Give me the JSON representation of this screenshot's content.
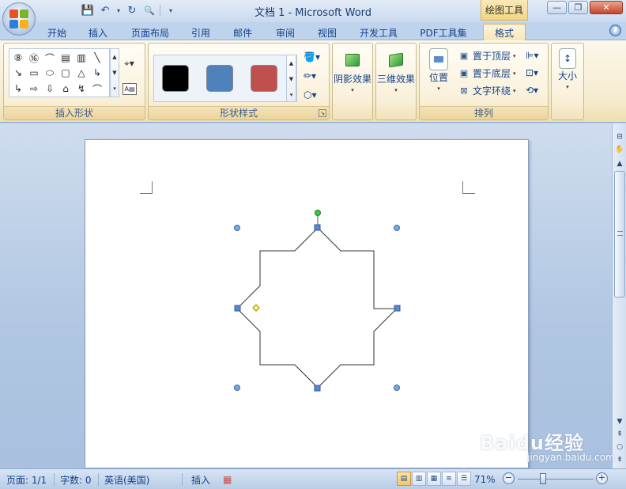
{
  "window": {
    "title": "文档 1 - Microsoft Word",
    "context_tab_title": "绘图工具",
    "controls": {
      "minimize": "—",
      "restore": "❐",
      "close": "✕"
    }
  },
  "quick_access": {
    "items": [
      {
        "name": "save-icon",
        "glyph": "💾"
      },
      {
        "name": "undo-icon",
        "glyph": "↶"
      },
      {
        "name": "dropdown-icon",
        "glyph": "▾"
      },
      {
        "name": "redo-icon",
        "glyph": "↻"
      },
      {
        "name": "print-preview-icon",
        "glyph": "🔍"
      },
      {
        "name": "customize-icon",
        "glyph": "▾"
      }
    ]
  },
  "tabs": [
    "开始",
    "插入",
    "页面布局",
    "引用",
    "邮件",
    "审阅",
    "视图",
    "开发工具",
    "PDF工具集",
    "格式"
  ],
  "active_tab": "格式",
  "help_glyph": "?",
  "ribbon": {
    "insert_shapes": {
      "label": "插入形状",
      "row1": [
        "⑧",
        "⑯",
        "⌒",
        "▤",
        "▥",
        "╲"
      ],
      "row2": [
        "↘",
        "▭",
        "⬭",
        "▢",
        "△",
        "↳"
      ],
      "row3": [
        "↳",
        "⇨",
        "⇩",
        "⌂",
        "↯",
        "⌒"
      ],
      "scroll": [
        "▲",
        "▼",
        "▾"
      ],
      "edit_shape_glyph": "⌖▾",
      "textbox_glyph": "A▤"
    },
    "shape_styles": {
      "label": "形状样式",
      "swatches": [
        "#000000",
        "#4f81bd",
        "#c0504d"
      ],
      "scroll": [
        "▲",
        "▼",
        "▾"
      ],
      "commands": [
        {
          "name": "fill-color-icon",
          "glyph": "🪣▾"
        },
        {
          "name": "outline-color-icon",
          "glyph": "✏▾"
        },
        {
          "name": "change-shape-icon",
          "glyph": "⬡▾"
        }
      ],
      "launcher": "↘"
    },
    "shadow_effects": {
      "label": "阴影效果",
      "chev": "▾"
    },
    "3d_effects": {
      "label": "三维效果",
      "chev": "▾"
    },
    "arrange": {
      "label": "排列",
      "position": {
        "label": "位置",
        "chev": "▾"
      },
      "items": [
        {
          "label": "置于顶层",
          "chev": "▾"
        },
        {
          "label": "置于底层",
          "chev": "▾"
        },
        {
          "label": "文字环绕",
          "chev": "▾"
        }
      ],
      "small_icons": [
        "⊫▾",
        "⊡▾",
        "⟲▾"
      ]
    },
    "size": {
      "label": "大小",
      "chev": "▾"
    }
  },
  "scrollbar": {
    "up": "▲",
    "down": "▼",
    "prev_page": "⇞",
    "select_browse": "○",
    "next_page": "⇟",
    "ruler_toggle": "⊟",
    "hand": "✋"
  },
  "status_bar": {
    "page": "页面: 1/1",
    "words": "字数: 0",
    "language": "英语(美国)",
    "mode": "插入",
    "macro_glyph": "▦",
    "zoom": "71%",
    "zoom_out": "−",
    "zoom_in": "+",
    "view_glyphs": [
      "▤",
      "▥",
      "▦",
      "≡",
      "☰"
    ]
  },
  "watermark": {
    "main": "Baidu经验",
    "sub": "jingyan.baidu.com"
  },
  "colors": {
    "ribbon_bg": "#f6ecd0",
    "accent": "#15428b",
    "selection_handle": "#4f81bd",
    "rotate_handle": "#33cc33",
    "adjust_handle": "#ffff66"
  }
}
